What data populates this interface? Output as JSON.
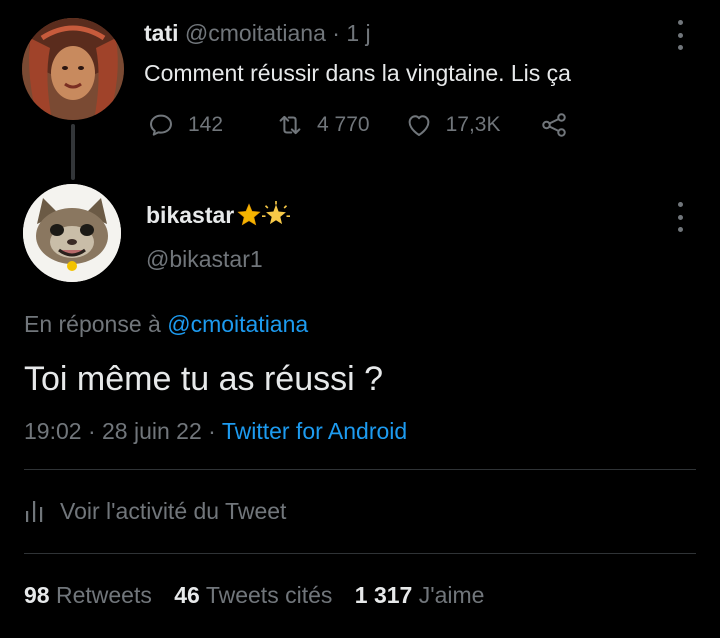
{
  "parent_tweet": {
    "author_name": "tati",
    "handle": "@cmoitatiana",
    "separator": "·",
    "time": "1 j",
    "text": "Comment réussir dans la vingtaine. Lis ça",
    "replies": "142",
    "retweets": "4 770",
    "likes": "17,3K",
    "icons": [
      "reply-icon",
      "retweet-icon",
      "like-icon",
      "share-icon",
      "more-icon"
    ]
  },
  "reply_tweet": {
    "author_name": "bikastar",
    "name_emoji": [
      "star-icon",
      "glowing-star-icon"
    ],
    "handle": "@bikastar1",
    "reply_prefix": "En réponse à",
    "reply_target": "@cmoitatiana",
    "text": "Toi même tu as réussi ?",
    "time": "19:02",
    "date": "28 juin 22",
    "meta_separator": "·",
    "client": "Twitter for Android",
    "activity_label": "Voir l'activité du Tweet"
  },
  "stats": {
    "retweets_count": "98",
    "retweets_label": "Retweets",
    "quotes_count": "46",
    "quotes_label": "Tweets cités",
    "likes_count": "1 317",
    "likes_label": "J'aime"
  },
  "colors": {
    "background": "#000000",
    "primary_text": "#e7e9ea",
    "secondary_text": "#71767b",
    "accent": "#1d9bf0",
    "divider": "#2f3336"
  }
}
